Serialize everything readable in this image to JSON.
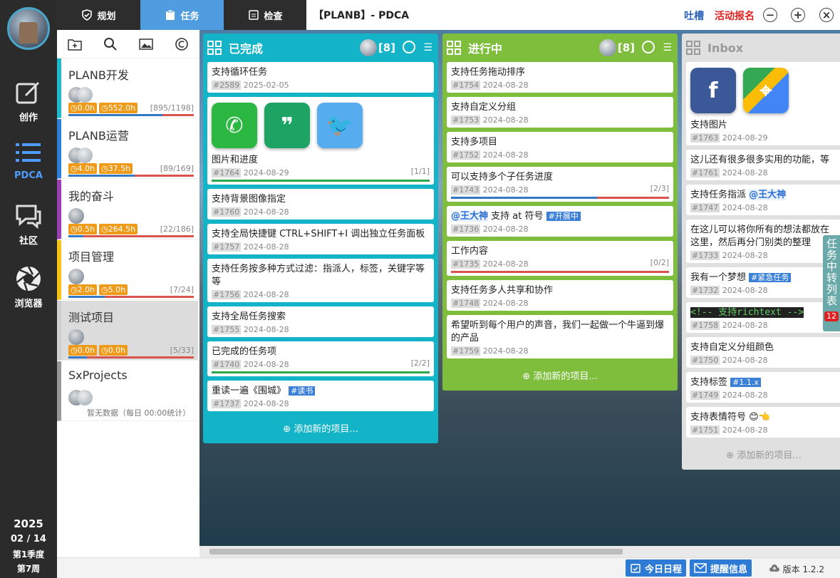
{
  "rail": {
    "items": [
      {
        "label": "创作",
        "icon": "edit-icon"
      },
      {
        "label": "PDCA",
        "icon": "list-icon"
      },
      {
        "label": "社区",
        "icon": "chat-icon"
      },
      {
        "label": "浏览器",
        "icon": "aperture-icon"
      }
    ],
    "year": "2025",
    "date": "02 / 14",
    "quarter": "第1季度",
    "week": "第7周"
  },
  "tabs": [
    "规划",
    "任务",
    "检查"
  ],
  "window": {
    "title": "【PLANB】- PDCA",
    "feedback": "吐槽",
    "signup": "活动报名",
    "colors": {
      "feedback": "#2a63b8",
      "signup": "#e02020"
    }
  },
  "projects": [
    {
      "name": "PLANB开发",
      "c1": "0.0h",
      "c2": "552.0h",
      "ratio": "[895/1198]",
      "progress": 0.75,
      "color": "#1fb9c9"
    },
    {
      "name": "PLANB运营",
      "c1": "4.0h",
      "c2": "37.5h",
      "ratio": "[89/169]",
      "progress": 0.53,
      "color": "#2f7fd8"
    },
    {
      "name": "我的奋斗",
      "c1": "0.5h",
      "c2": "264.5h",
      "ratio": "[22/186]",
      "progress": 0.12,
      "color": "#9b3fb5"
    },
    {
      "name": "项目管理",
      "c1": "2.0h",
      "c2": "5.0h",
      "ratio": "[7/24]",
      "progress": 0.29,
      "color": "#f5c21a"
    },
    {
      "name": "测试项目",
      "c1": "0.0h",
      "c2": "0.0h",
      "ratio": "[5/33]",
      "progress": 0.15,
      "color": "#cfcfcf"
    },
    {
      "name": "SxProjects",
      "note": "暂无数据（每日 00:00统计）",
      "color": "#999"
    }
  ],
  "columns": [
    {
      "title": "已完成",
      "count": "[8]",
      "color": "#14b4c8",
      "add": "添加新的项目...",
      "cards": [
        {
          "title": "支持循环任务",
          "id": "#2589",
          "date": "2025-02-05"
        },
        {
          "title": "图片和进度",
          "id": "#1764",
          "date": "2024-08-29",
          "prog": "[1/1]",
          "apps": [
            "whatsapp",
            "hangouts",
            "twitter"
          ],
          "pbar": 1.0
        },
        {
          "title": "支持背景图像指定",
          "id": "#1760",
          "date": "2024-08-28"
        },
        {
          "title": "支持全局快捷键 CTRL+SHIFT+I 调出独立任务面板",
          "id": "#1757",
          "date": "2024-08-28"
        },
        {
          "title": "支持任务按多种方式过滤：指派人，标签，关键字等等",
          "id": "#1756",
          "date": "2024-08-28"
        },
        {
          "title": "支持全局任务搜索",
          "id": "#1755",
          "date": "2024-08-28"
        },
        {
          "title": "已完成的任务项",
          "id": "#1740",
          "date": "2024-08-28",
          "prog": "[2/2]",
          "pbar": 1.0
        },
        {
          "title": "重读一遍《围城》",
          "id": "#1737",
          "date": "2024-08-28",
          "tag": "#读书"
        }
      ]
    },
    {
      "title": "进行中",
      "count": "[8]",
      "color": "#7fbe3d",
      "add": "添加新的项目...",
      "cards": [
        {
          "title": "支持任务拖动排序",
          "id": "#1754",
          "date": "2024-08-28"
        },
        {
          "title": "支持自定义分组",
          "id": "#1753",
          "date": "2024-08-28"
        },
        {
          "title": "支持多项目",
          "id": "#1752",
          "date": "2024-08-28"
        },
        {
          "title": "可以支持多个子任务进度",
          "id": "#1743",
          "date": "2024-08-28",
          "prog": "[2/3]",
          "pbar": 0.67
        },
        {
          "title": "支持 at 符号",
          "mention": "@王大神",
          "id": "#1736",
          "date": "2024-08-28",
          "tag": "#开展中"
        },
        {
          "title": "工作内容",
          "id": "#1735",
          "date": "2024-08-28",
          "prog": "[0/2]",
          "pbar": 0.0
        },
        {
          "title": "支持任务多人共享和协作",
          "id": "#1748",
          "date": "2024-08-28"
        },
        {
          "title": "希望听到每个用户的声音，我们一起做一个牛逼到爆的产品",
          "id": "#1759",
          "date": "2024-08-28"
        }
      ]
    },
    {
      "title": "Inbox",
      "color": "#e0e0e0",
      "add": "添加新的项目...",
      "cards": [
        {
          "title": "支持图片",
          "id": "#1763",
          "date": "2024-08-29",
          "apps": [
            "facebook",
            "maps"
          ]
        },
        {
          "title": "这儿还有很多很多实用的功能，等",
          "id": "#1761",
          "date": "2024-08-28"
        },
        {
          "title": "支持任务指派",
          "mention2": "@王大神",
          "id": "#1747",
          "date": "2024-08-28"
        },
        {
          "title": "在这儿可以将你所有的想法都放在这里，然后再分门别类的整理",
          "id": "#1733",
          "date": "2024-08-28"
        },
        {
          "title": "我有一个梦想",
          "id": "#1732",
          "date": "2024-08-28",
          "tag": "#紧急任务"
        },
        {
          "title": "<!-- 支持richtext -->",
          "id": "#1758",
          "date": "2024-08-28",
          "code": true
        },
        {
          "title": "支持自定义分组颜色",
          "id": "#1750",
          "date": "2024-08-28"
        },
        {
          "title": "支持标签",
          "id": "#1749",
          "date": "2024-08-28",
          "tag": "#1.1.x"
        },
        {
          "title": "支持表情符号 😊👈",
          "id": "#1751",
          "date": "2024-08-28"
        }
      ]
    }
  ],
  "sideTab": {
    "label": "任务中转列表",
    "badge": "12"
  },
  "status": {
    "today": "今日日程",
    "remind": "提醒信息",
    "version": "版本 1.2.2"
  }
}
